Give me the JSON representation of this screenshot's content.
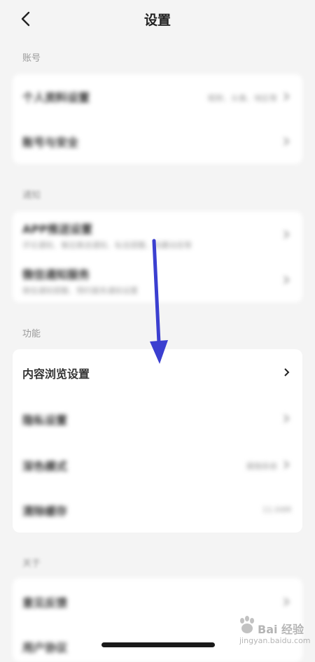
{
  "header": {
    "title": "设置"
  },
  "sections": {
    "account": {
      "label": "账号",
      "items": [
        {
          "title": "个人资料设置",
          "value": "昵称、头像、地区等"
        },
        {
          "title": "账号与安全",
          "value": ""
        }
      ]
    },
    "notify": {
      "label": "通知",
      "items": [
        {
          "title": "APP推送设置",
          "sub": "评论通知、餐后推送通知、私信提醒、收藏动态等"
        },
        {
          "title": "微信通知服务",
          "sub": "微信通知提醒、预约服务通知设置"
        }
      ]
    },
    "function": {
      "label": "功能",
      "items": [
        {
          "title": "内容浏览设置",
          "value": ""
        },
        {
          "title": "隐私设置",
          "value": ""
        },
        {
          "title": "深色模式",
          "value": "跟随系统"
        },
        {
          "title": "清除缓存",
          "value": "11.04M"
        }
      ]
    },
    "about": {
      "label": "关于",
      "items": [
        {
          "title": "意见反馈",
          "value": ""
        },
        {
          "title": "用户协议",
          "value": ""
        }
      ]
    }
  },
  "watermark": {
    "text": "Bai 经验",
    "sub": "jingyan.baidu.com"
  },
  "colors": {
    "arrow": "#3b3fd0",
    "background": "#f4f4f4",
    "card": "#ffffff"
  }
}
